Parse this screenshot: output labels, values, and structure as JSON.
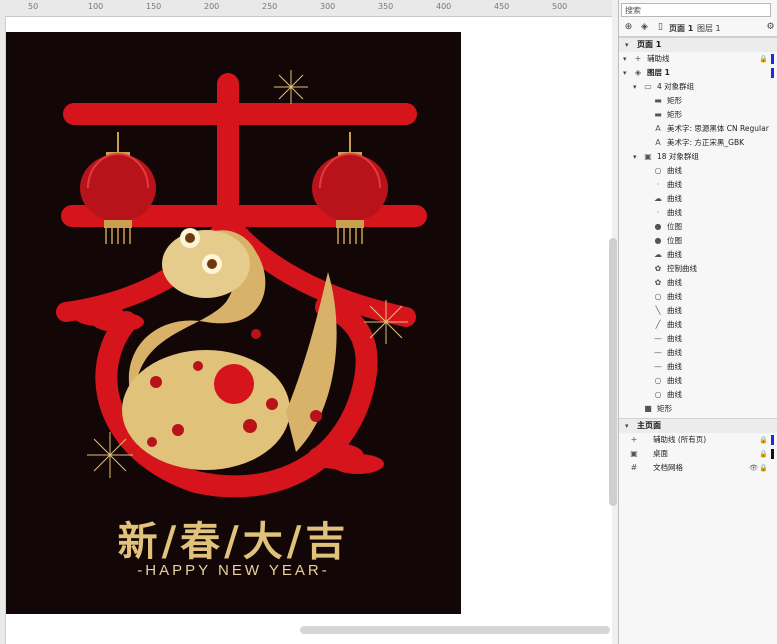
{
  "ruler": {
    "marks": [
      "50",
      "100",
      "150",
      "200",
      "250",
      "300",
      "350",
      "400",
      "450",
      "500"
    ]
  },
  "poster": {
    "character": "春",
    "title": "新/春/大/吉",
    "subtitle": "-HAPPY NEW YEAR-",
    "colors": {
      "background": "#130606",
      "red": "#d5151b",
      "gold": "#e0c27a",
      "gold_dark": "#b7873f"
    }
  },
  "panel": {
    "search_placeholder": "搜索",
    "tabs": {
      "page": "页面 1",
      "layer": "图层 1"
    },
    "page_section": "页面 1",
    "layers": [
      {
        "name": "辅助线",
        "indent": 0,
        "icon": "guides-icon",
        "glyph": "+",
        "lock": true
      },
      {
        "name": "图层 1",
        "indent": 0,
        "icon": "layer-icon",
        "glyph": "◈",
        "bold": true
      },
      {
        "name": "4 对象群组",
        "indent": 1,
        "icon": "group-icon",
        "glyph": "▭"
      },
      {
        "name": "矩形",
        "indent": 2,
        "icon": "rectangle-icon",
        "glyph": "▬"
      },
      {
        "name": "矩形",
        "indent": 2,
        "icon": "rectangle-icon",
        "glyph": "▬"
      },
      {
        "name": "美术字: 思源黑体 CN Regular",
        "indent": 2,
        "icon": "text-icon",
        "glyph": "A"
      },
      {
        "name": "美术字: 方正宋黑_GBK",
        "indent": 2,
        "icon": "text-icon",
        "glyph": "A"
      },
      {
        "name": "18 对象群组",
        "indent": 1,
        "icon": "group-icon",
        "glyph": "▣"
      },
      {
        "name": "曲线",
        "indent": 2,
        "icon": "curve-icon",
        "glyph": "○"
      },
      {
        "name": "曲线",
        "indent": 2,
        "icon": "curve-icon",
        "glyph": "·"
      },
      {
        "name": "曲线",
        "indent": 2,
        "icon": "curve-icon",
        "glyph": "☁"
      },
      {
        "name": "曲线",
        "indent": 2,
        "icon": "curve-icon",
        "glyph": "·"
      },
      {
        "name": "位图",
        "indent": 2,
        "icon": "bitmap-icon",
        "glyph": "●"
      },
      {
        "name": "位图",
        "indent": 2,
        "icon": "bitmap-icon",
        "glyph": "●"
      },
      {
        "name": "曲线",
        "indent": 2,
        "icon": "curve-icon",
        "glyph": "☁"
      },
      {
        "name": "控制曲线",
        "indent": 2,
        "icon": "control-curve-icon",
        "glyph": "✿"
      },
      {
        "name": "曲线",
        "indent": 2,
        "icon": "curve-icon",
        "glyph": "✿"
      },
      {
        "name": "曲线",
        "indent": 2,
        "icon": "curve-icon",
        "glyph": "○"
      },
      {
        "name": "曲线",
        "indent": 2,
        "icon": "curve-icon",
        "glyph": "╲"
      },
      {
        "name": "曲线",
        "indent": 2,
        "icon": "curve-icon",
        "glyph": "╱"
      },
      {
        "name": "曲线",
        "indent": 2,
        "icon": "curve-icon",
        "glyph": "—"
      },
      {
        "name": "曲线",
        "indent": 2,
        "icon": "curve-icon",
        "glyph": "—"
      },
      {
        "name": "曲线",
        "indent": 2,
        "icon": "curve-icon",
        "glyph": "—"
      },
      {
        "name": "曲线",
        "indent": 2,
        "icon": "curve-icon",
        "glyph": "○"
      },
      {
        "name": "曲线",
        "indent": 2,
        "icon": "curve-icon",
        "glyph": "○"
      },
      {
        "name": "矩形",
        "indent": 1,
        "icon": "black-rectangle-icon",
        "glyph": "■"
      }
    ],
    "master_section": "主页面",
    "master_layers": [
      {
        "name": "辅助线 (所有页)",
        "icon": "guides-icon",
        "glyph": "+"
      },
      {
        "name": "桌面",
        "icon": "desktop-icon",
        "glyph": "▣"
      },
      {
        "name": "文档网格",
        "icon": "grid-icon",
        "glyph": "#"
      }
    ]
  }
}
